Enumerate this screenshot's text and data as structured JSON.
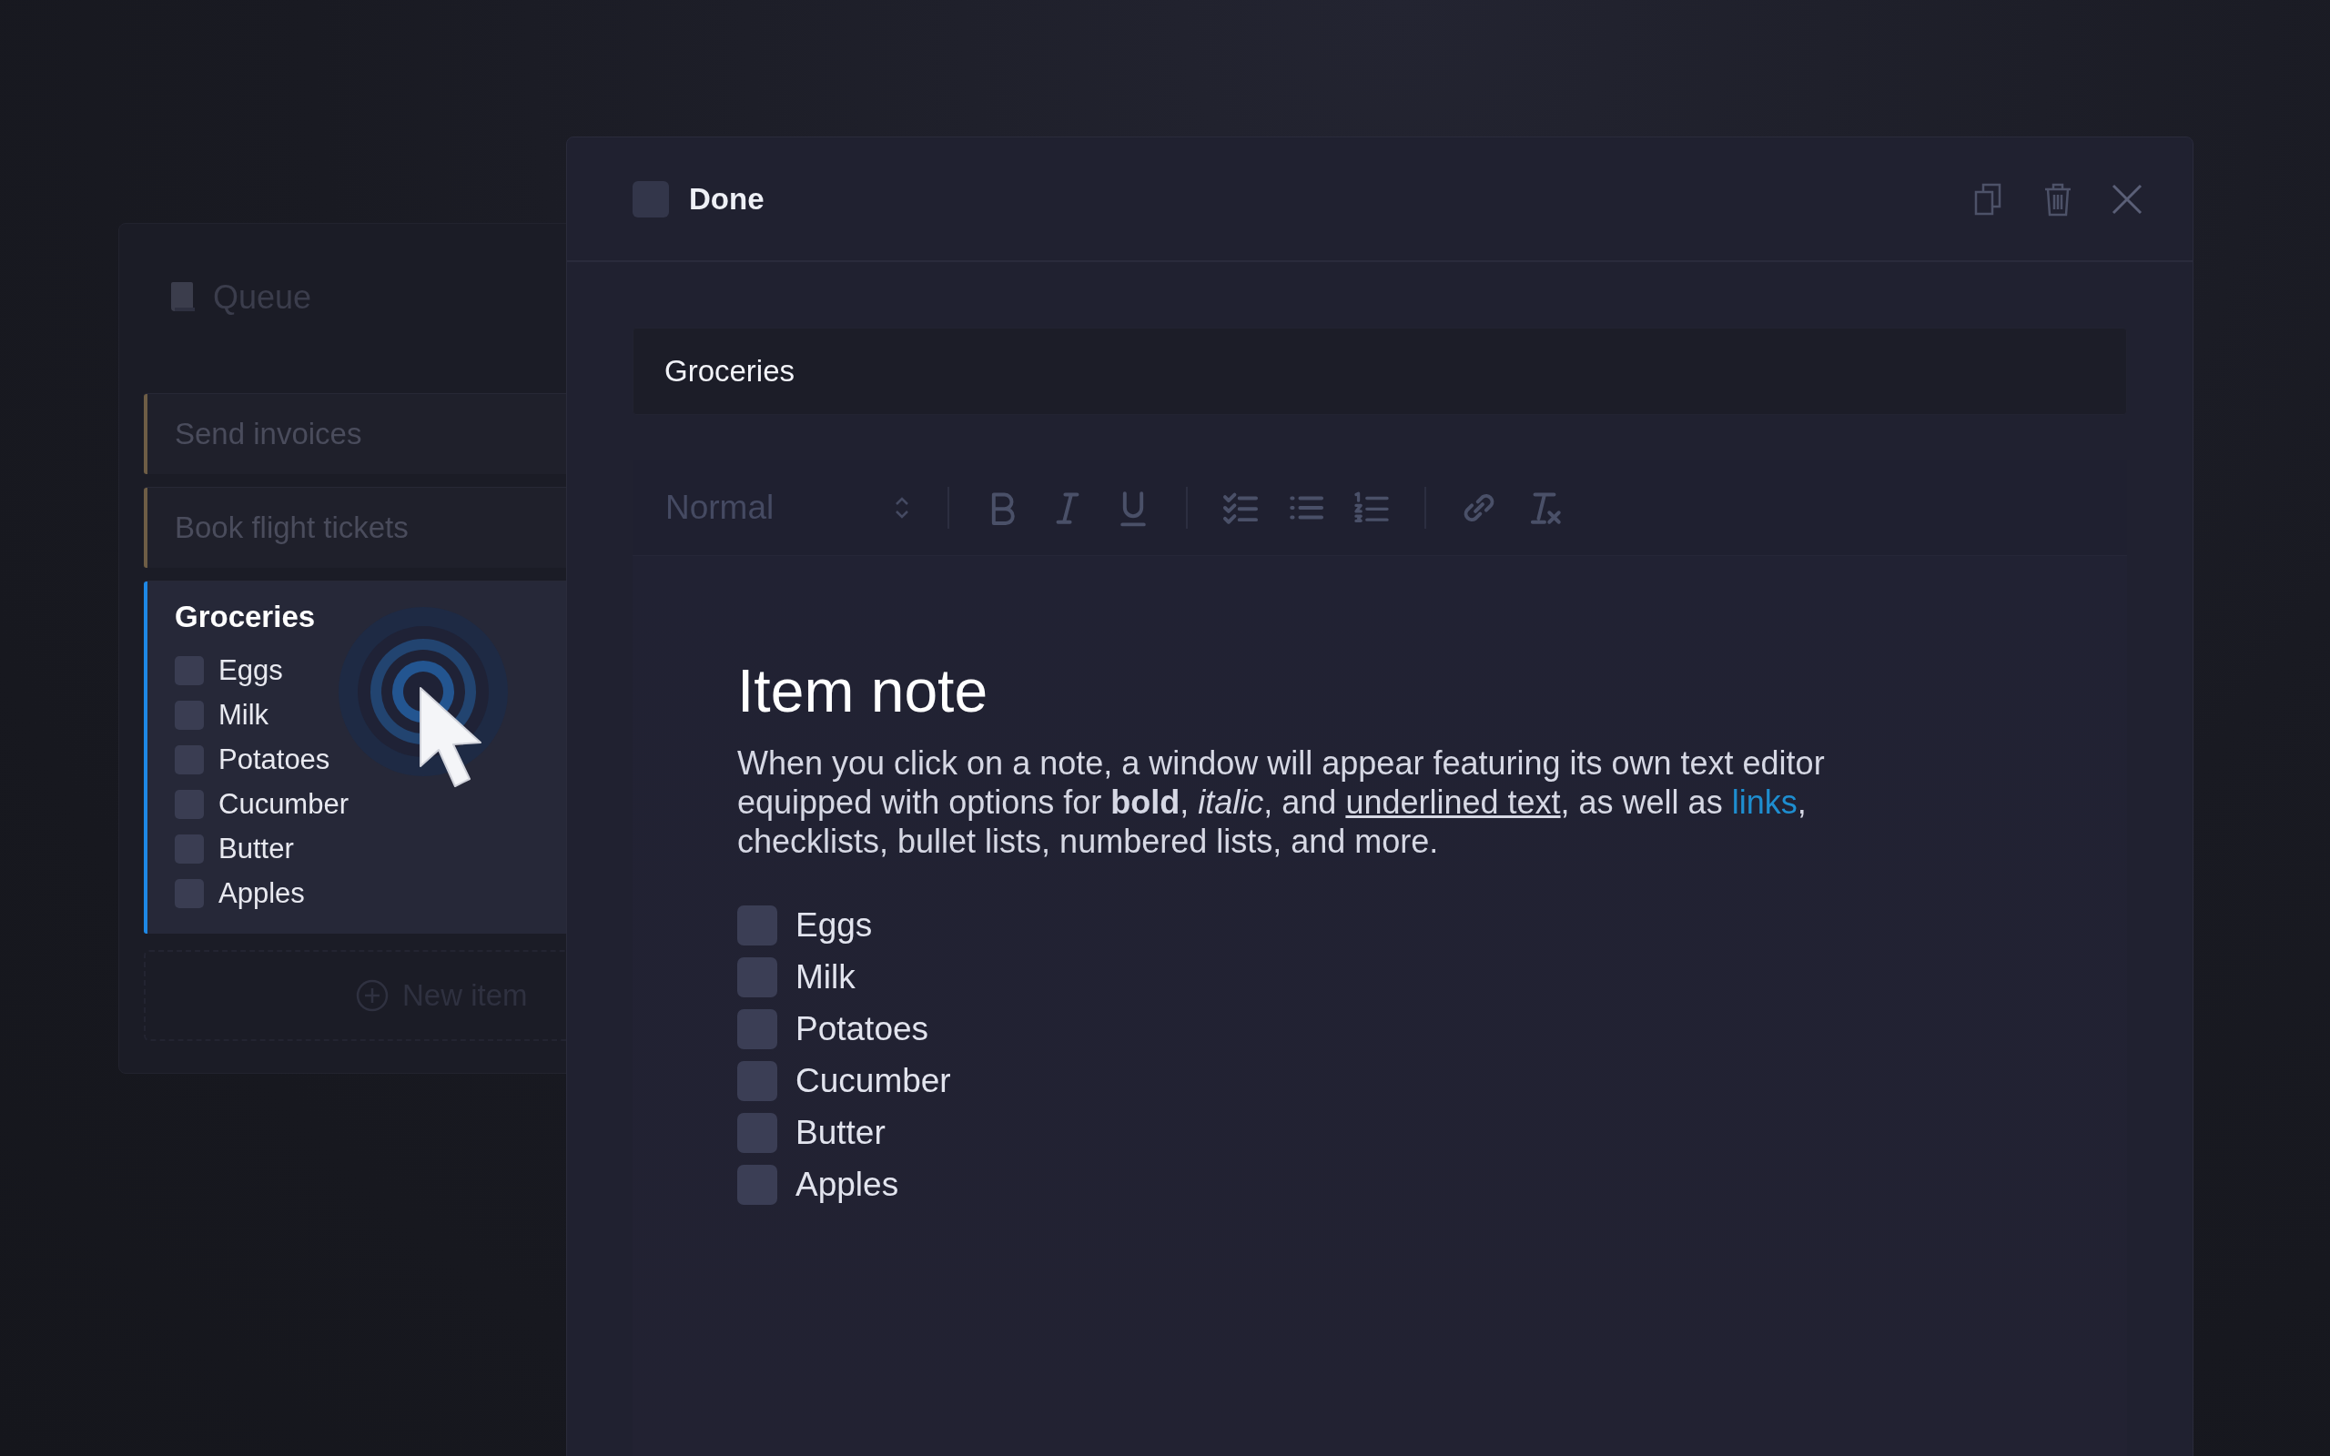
{
  "queue": {
    "title": "Queue",
    "items": [
      {
        "title": "Send invoices",
        "selected": false,
        "color": "#6e5d45"
      },
      {
        "title": "Book flight tickets",
        "selected": false,
        "color": "#6e5d45"
      },
      {
        "title": "Groceries",
        "selected": true,
        "color": "#1e88e5",
        "checklist": [
          {
            "label": "Eggs",
            "checked": false
          },
          {
            "label": "Milk",
            "checked": false
          },
          {
            "label": "Potatoes",
            "checked": false
          },
          {
            "label": "Cucumber",
            "checked": false
          },
          {
            "label": "Butter",
            "checked": false
          },
          {
            "label": "Apples",
            "checked": false
          }
        ]
      }
    ],
    "new_item": "New item"
  },
  "modal": {
    "done": {
      "label": "Done",
      "checked": false
    },
    "title_field": {
      "value": "Groceries"
    },
    "toolbar": {
      "format": "Normal"
    },
    "editor": {
      "heading": "Item note",
      "paragraph": [
        {
          "kind": "text",
          "text": "When you click on a note, a window will appear featuring its own text editor equipped with options for "
        },
        {
          "kind": "bold",
          "text": "bold"
        },
        {
          "kind": "text",
          "text": ", "
        },
        {
          "kind": "italic",
          "text": "italic"
        },
        {
          "kind": "text",
          "text": ", and "
        },
        {
          "kind": "underline",
          "text": "underlined text"
        },
        {
          "kind": "text",
          "text": ", as well as "
        },
        {
          "kind": "link",
          "text": "links"
        },
        {
          "kind": "text",
          "text": ", checklists, bullet lists, numbered lists, and more."
        }
      ],
      "checklist": [
        {
          "label": "Eggs",
          "checked": false
        },
        {
          "label": "Milk",
          "checked": false
        },
        {
          "label": "Potatoes",
          "checked": false
        },
        {
          "label": "Cucumber",
          "checked": false
        },
        {
          "label": "Butter",
          "checked": false
        },
        {
          "label": "Apples",
          "checked": false
        }
      ]
    }
  }
}
